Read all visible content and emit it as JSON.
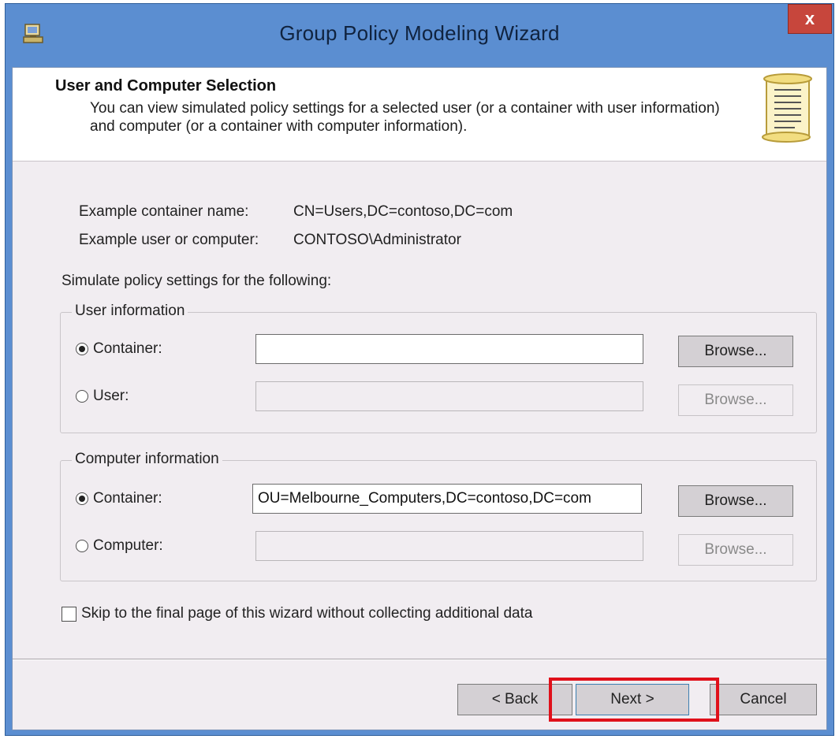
{
  "window": {
    "title": "Group Policy Modeling Wizard",
    "close_label": "x"
  },
  "header": {
    "title": "User and Computer Selection",
    "description": "You can view simulated policy settings for a selected user (or a container with user information) and computer (or a container with computer information)."
  },
  "examples": {
    "container_label": "Example container name:",
    "container_value": "CN=Users,DC=contoso,DC=com",
    "user_label": "Example user or computer:",
    "user_value": "CONTOSO\\Administrator"
  },
  "simulate_label": "Simulate policy settings for the following:",
  "user_info": {
    "legend": "User information",
    "container_label": "Container:",
    "container_value": "",
    "user_label": "User:",
    "user_value": "",
    "browse_label": "Browse..."
  },
  "computer_info": {
    "legend": "Computer information",
    "container_label": "Container:",
    "container_value": "OU=Melbourne_Computers,DC=contoso,DC=com",
    "computer_label": "Computer:",
    "computer_value": "",
    "browse_label": "Browse..."
  },
  "skip_label": "Skip to the final page of this wizard without collecting additional data",
  "footer": {
    "back_label": "< Back",
    "next_label": "Next >",
    "cancel_label": "Cancel"
  },
  "colors": {
    "titlebar": "#5b8ed1",
    "close": "#c7463c",
    "highlight": "#e0101a"
  }
}
